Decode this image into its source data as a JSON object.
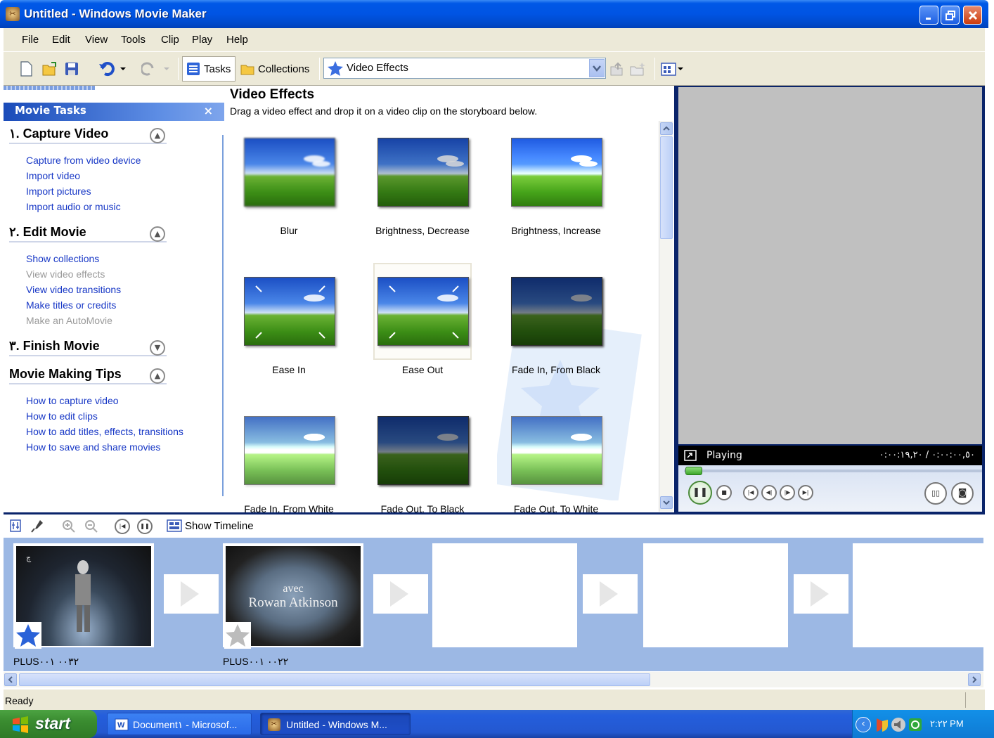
{
  "window": {
    "title": "Untitled - Windows Movie Maker"
  },
  "menu": [
    "File",
    "Edit",
    "View",
    "Tools",
    "Clip",
    "Play",
    "Help"
  ],
  "toolbar": {
    "tasks_label": "Tasks",
    "collections_label": "Collections",
    "effects_dropdown": "Video Effects"
  },
  "task_pane": {
    "header": "Movie Tasks",
    "close_label": "×",
    "sections": [
      {
        "title": "١. Capture Video",
        "links": [
          "Capture from video device",
          "Import video",
          "Import pictures",
          "Import audio or music"
        ]
      },
      {
        "title": "٢. Edit Movie",
        "links": [
          "Show collections",
          "View video effects",
          "View video transitions",
          "Make titles or credits",
          "Make an AutoMovie"
        ]
      },
      {
        "title": "٣. Finish Movie"
      },
      {
        "title": "Movie Making Tips",
        "links": [
          "How to capture video",
          "How to edit clips",
          "How to add titles, effects, transitions",
          "How to save and share movies"
        ]
      }
    ]
  },
  "content": {
    "title": "Video Effects",
    "subtitle": "Drag a video effect and drop it on a video clip on the storyboard below.",
    "effects": [
      "Blur",
      "Brightness, Decrease",
      "Brightness, Increase",
      "Ease In",
      "Ease Out",
      "Fade In, From Black",
      "Fade In, From White",
      "Fade Out, To Black",
      "Fade Out, To White"
    ]
  },
  "preview": {
    "status": "Playing",
    "time": "٠:٠٠:٠٠,٥٠ / ٠:٠٠:١٩,٢٠"
  },
  "storyboard": {
    "show_timeline_label": "Show Timeline",
    "clips": [
      {
        "name": "PLUS٠٠٣٢ ٠٠١"
      },
      {
        "name": "PLUS٠٠٢٢ ٠٠١",
        "overlay_line1": "avec",
        "overlay_line2": "Rowan Atkinson"
      }
    ]
  },
  "status": {
    "text": "Ready"
  },
  "taskbar": {
    "start_label": "start",
    "tasks": [
      "Document١ - Microsof...",
      "Untitled - Windows M..."
    ],
    "clock": "٢:٢٢ PM"
  },
  "colors": {
    "titlebar": "#0054e3",
    "link": "#1838c6",
    "storyboard": "#9cb8e4",
    "taskbar": "#245edc",
    "start": "#3a8c30"
  }
}
